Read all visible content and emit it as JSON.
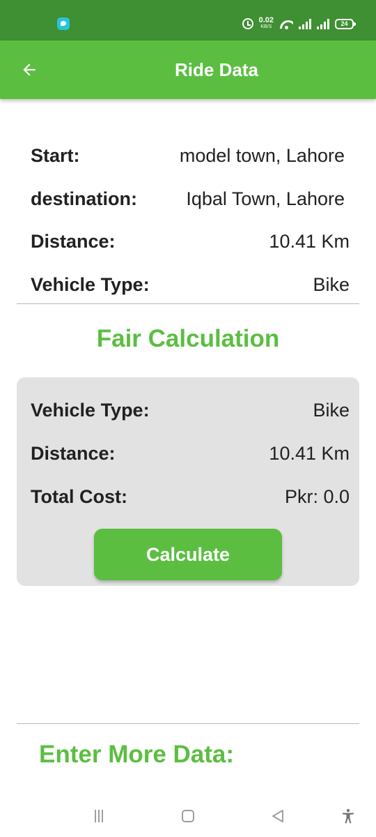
{
  "status_bar": {
    "net_speed_value": "0.02",
    "net_speed_unit": "KB/S",
    "battery": "24",
    "icons": [
      "notification-icon",
      "alarm-icon",
      "wifi-icon",
      "signal-icon",
      "signal-icon",
      "battery-icon"
    ]
  },
  "app_bar": {
    "title": "Ride Data",
    "back_icon": "arrow-left-icon"
  },
  "ride": {
    "start_label": "Start:",
    "start_value": "model town, Lahore",
    "destination_label": "destination:",
    "destination_value": "Iqbal Town, Lahore",
    "distance_label": "Distance:",
    "distance_value": "10.41 Km",
    "vehicle_label": "Vehicle Type:",
    "vehicle_value": "Bike"
  },
  "fare": {
    "title": "Fair Calculation",
    "vehicle_label": "Vehicle Type:",
    "vehicle_value": "Bike",
    "distance_label": "Distance:",
    "distance_value": "10.41 Km",
    "cost_label": "Total Cost:",
    "cost_value": "Pkr: 0.0",
    "calculate_label": "Calculate"
  },
  "more": {
    "title": "Enter More Data:"
  },
  "colors": {
    "status_bar": "#3f8f33",
    "primary": "#5bbe41",
    "card": "#e2e2e2"
  }
}
